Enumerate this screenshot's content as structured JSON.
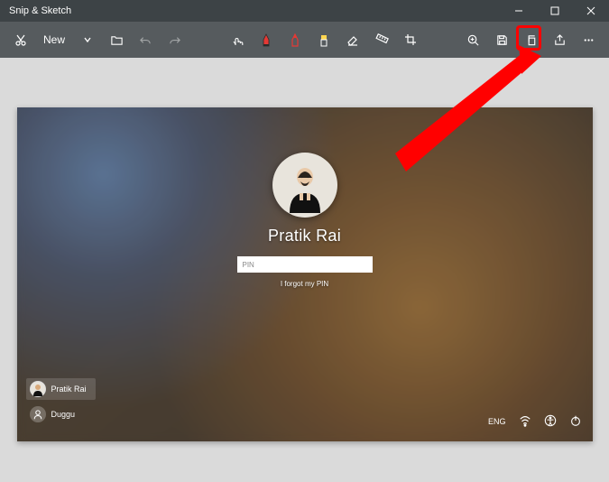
{
  "app": {
    "title": "Snip & Sketch"
  },
  "toolbar": {
    "new_label": "New"
  },
  "lockscreen": {
    "username": "Pratik Rai",
    "pin_placeholder": "PIN",
    "forgot_label": "I forgot my PIN",
    "lang": "ENG",
    "users": [
      {
        "name": "Pratik Rai"
      },
      {
        "name": "Duggu"
      }
    ]
  }
}
